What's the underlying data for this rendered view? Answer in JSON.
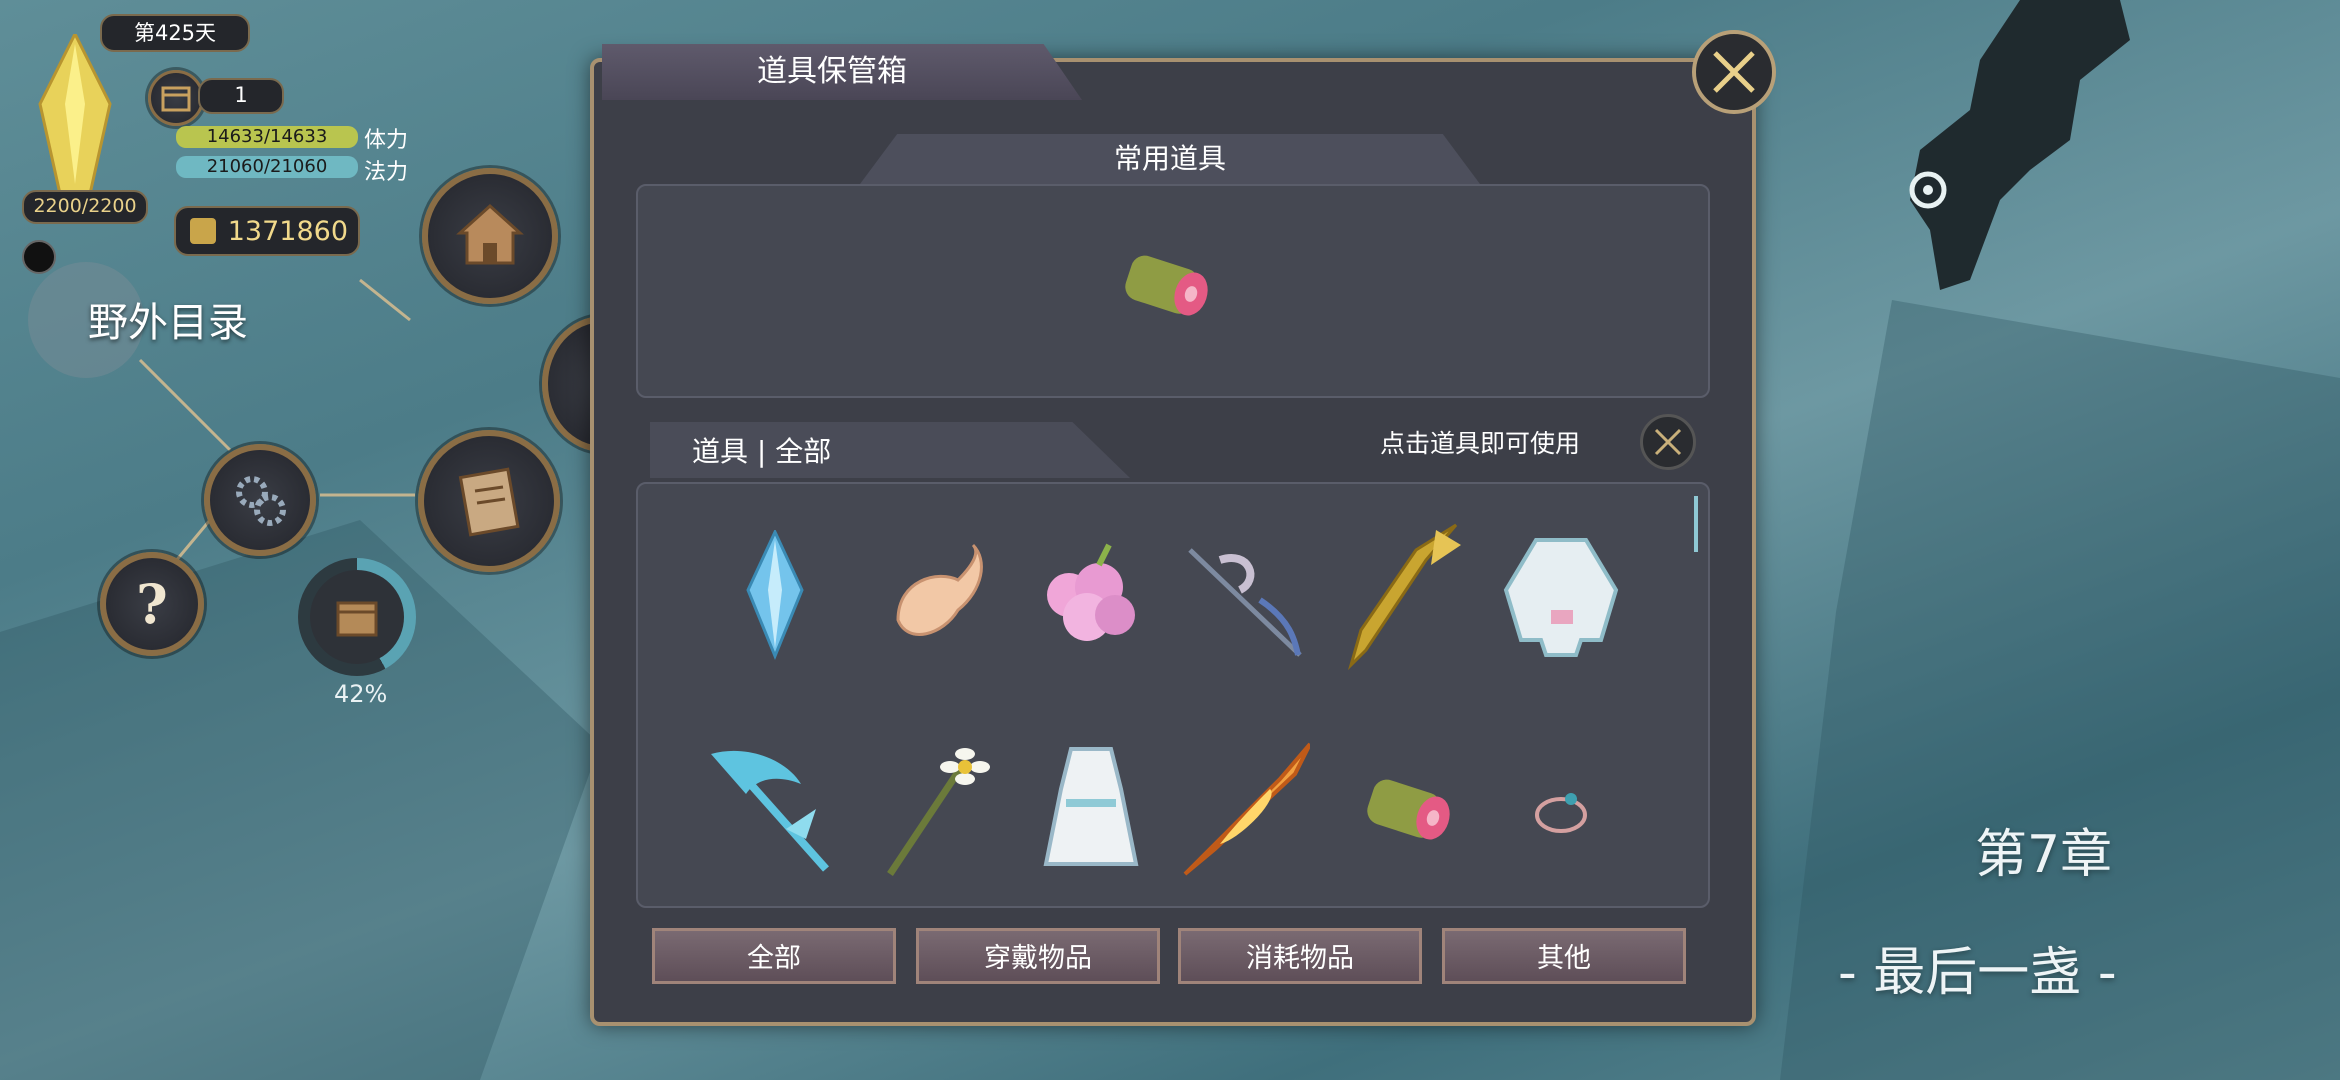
{
  "hud": {
    "day": "第425天",
    "calendar_count": "1",
    "crystal_value": "2200/2200",
    "hp": "14633/14633",
    "hp_label": "体力",
    "mp": "21060/21060",
    "mp_label": "法力",
    "gold": "1371860",
    "field_menu": "野外目录",
    "progress_percent": "42%",
    "progress_value": 0.42
  },
  "panel": {
    "title": "道具保管箱",
    "common_header": "常用道具",
    "items_tab": "道具 | 全部",
    "use_hint": "点击道具即可使用",
    "common_items": [
      "meat-icon"
    ],
    "items": [
      "crystal-icon",
      "horn-icon",
      "pink-fruit-icon",
      "blade-staff-icon",
      "golden-sword-icon",
      "white-coat-icon",
      "ice-scythe-icon",
      "flower-staff-icon",
      "white-dress-icon",
      "fire-sword-icon",
      "meat-icon",
      "ring-icon"
    ],
    "tabs": [
      "全部",
      "穿戴物品",
      "消耗物品",
      "其他"
    ]
  },
  "chapter": {
    "title": "第7章",
    "subtitle": "- 最后一盏 -"
  }
}
